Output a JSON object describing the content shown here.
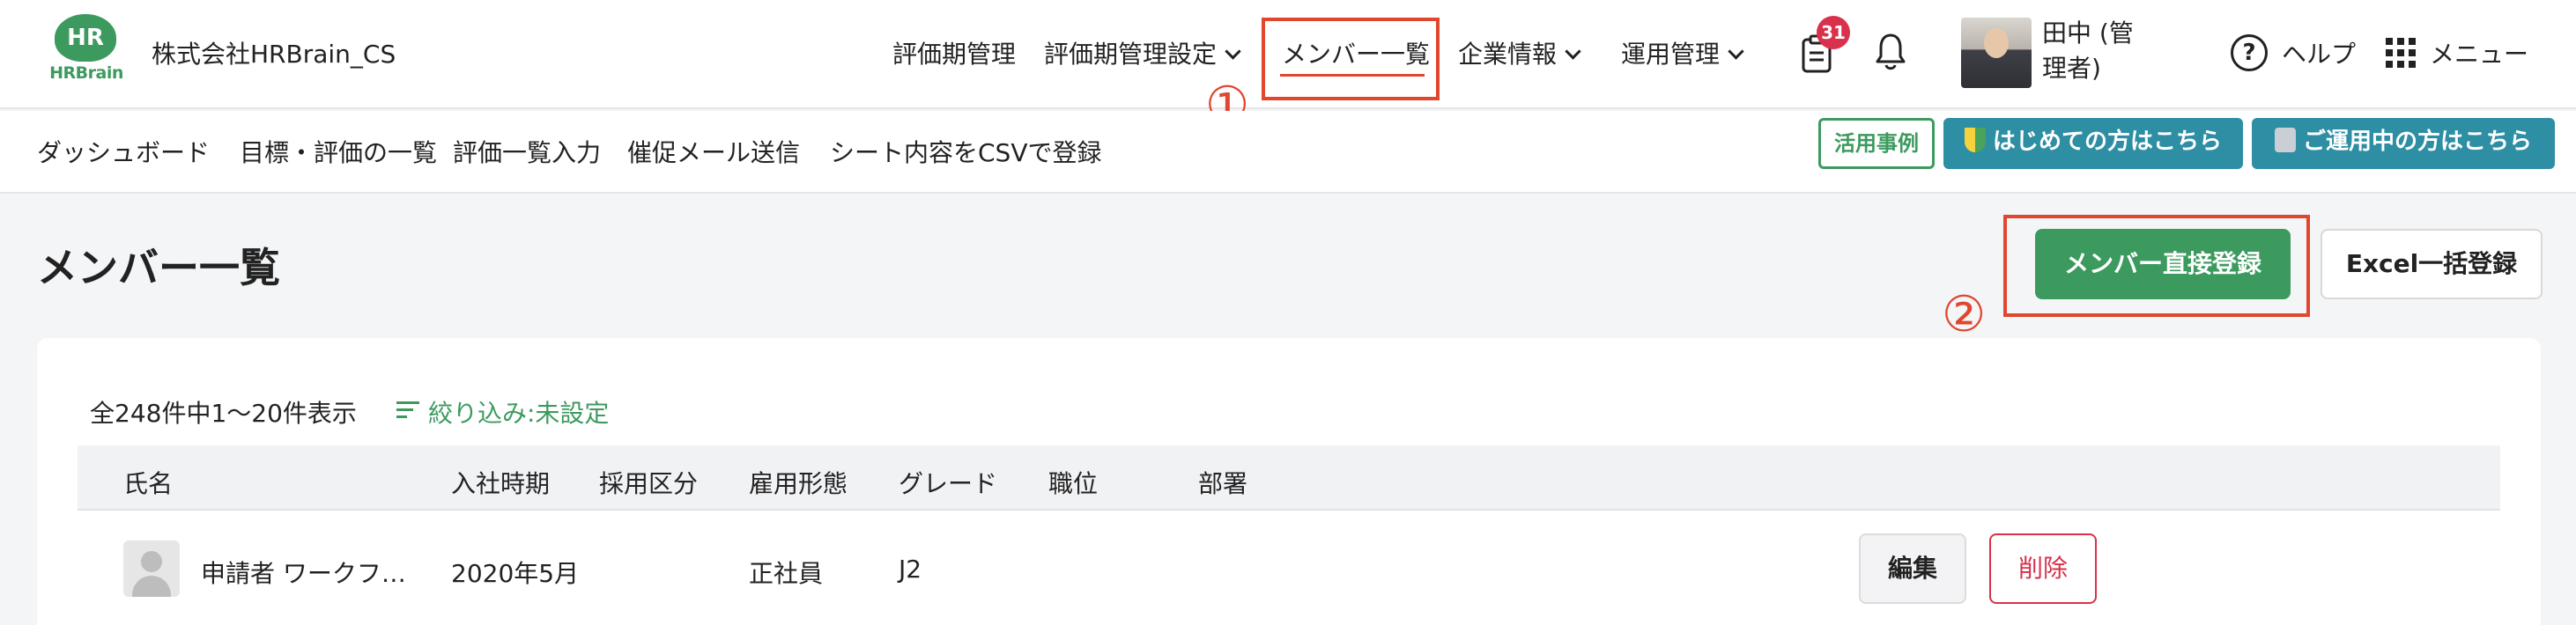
{
  "header": {
    "logo_mark": "HR",
    "logo_text": "HRBrain",
    "company": "株式会社HRBrain_CS",
    "nav": [
      {
        "label": "評価期管理"
      },
      {
        "label": "評価期管理設定"
      },
      {
        "label": "メンバー一覧"
      },
      {
        "label": "企業情報"
      },
      {
        "label": "運用管理"
      }
    ],
    "notification_count": "31",
    "user_name": "田中 (管理者)",
    "help_label": "ヘルプ",
    "menu_label": "メニュー"
  },
  "markers": {
    "one": "①",
    "two": "②"
  },
  "subnav": {
    "items": [
      "ダッシュボード",
      "目標・評価の一覧",
      "評価一覧入力",
      "催促メール送信",
      "シート内容をCSVで登録"
    ],
    "case_study": "活用事例",
    "first_time": "はじめての方はこちら",
    "in_use": "ご運用中の方はこちら"
  },
  "page": {
    "title": "メンバー一覧",
    "primary_button": "メンバー直接登録",
    "excel_button": "Excel一括登録"
  },
  "list": {
    "count_text": "全248件中1〜20件表示",
    "filter_text": "絞り込み:未設定",
    "columns": [
      "氏名",
      "入社時期",
      "採用区分",
      "雇用形態",
      "グレード",
      "職位",
      "部署"
    ],
    "rows": [
      {
        "name": "申請者 ワークフ…",
        "joined": "2020年5月",
        "hire_type": "",
        "employment": "正社員",
        "grade": "J2",
        "position": "",
        "department": "",
        "edit": "編集",
        "delete": "削除"
      }
    ]
  },
  "colors": {
    "brand_green": "#3d9a5f",
    "highlight_red": "#e0472e",
    "teal": "#2e8ea3",
    "danger": "#d9304b"
  }
}
